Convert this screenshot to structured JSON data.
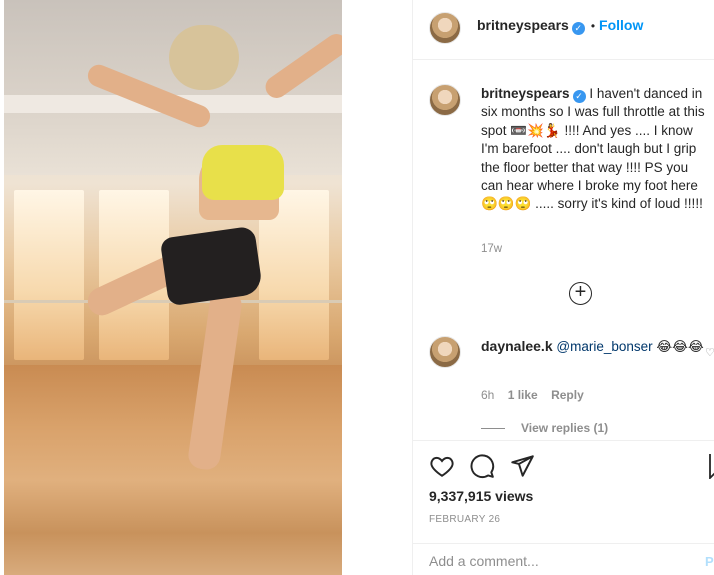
{
  "post": {
    "username": "britneyspears",
    "verified_mark": "✓",
    "separator": "•",
    "follow_label": "Follow"
  },
  "caption": {
    "username": "britneyspears",
    "text": "I haven't danced in six months so I was full throttle at this spot 📼💥💃 !!!! And yes .... I know I'm barefoot .... don't laugh but I grip the floor better that way !!!! PS you can hear where I broke my foot here 🙄🙄🙄 ..... sorry it's kind of loud !!!!!",
    "time": "17w"
  },
  "load_more_icon": "plus-circle-icon",
  "comment": {
    "username": "daynalee.k",
    "mention": "@marie_bonser",
    "text": "😂😂😂",
    "time": "6h",
    "likes": "1 like",
    "reply_label": "Reply",
    "view_replies": "View replies (1)"
  },
  "actions": {
    "icons": [
      "heart-icon",
      "comment-icon",
      "share-icon",
      "bookmark-icon"
    ],
    "views": "9,337,915 views",
    "date": "FEBRUARY 26"
  },
  "add_comment": {
    "placeholder": "Add a comment...",
    "post_label": "Po"
  },
  "colors": {
    "link": "#0095f6",
    "verified": "#3897f0",
    "muted": "#8e8e8e",
    "text": "#262626"
  }
}
